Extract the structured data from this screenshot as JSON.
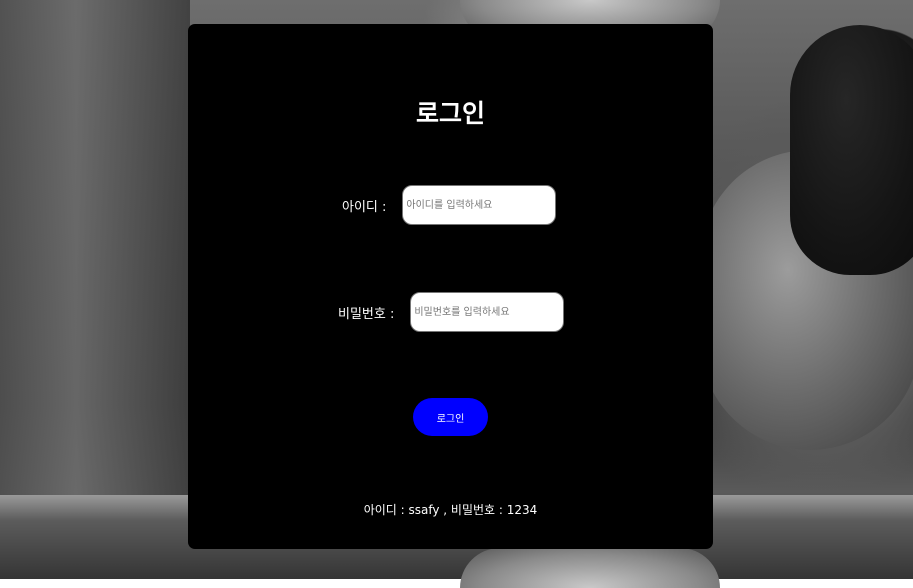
{
  "login": {
    "title": "로그인",
    "id_label": "아이디 :",
    "id_placeholder": "아이디를 입력하세요",
    "id_value": "",
    "pw_label": "비밀번호 :",
    "pw_placeholder": "비밀번호를 입력하세요",
    "pw_value": "",
    "button_label": "로그인",
    "hint": "아이디 : ssafy , 비밀번호 : 1234"
  },
  "colors": {
    "card_background": "#000000",
    "button_background": "#0000ff",
    "text": "#ffffff"
  }
}
